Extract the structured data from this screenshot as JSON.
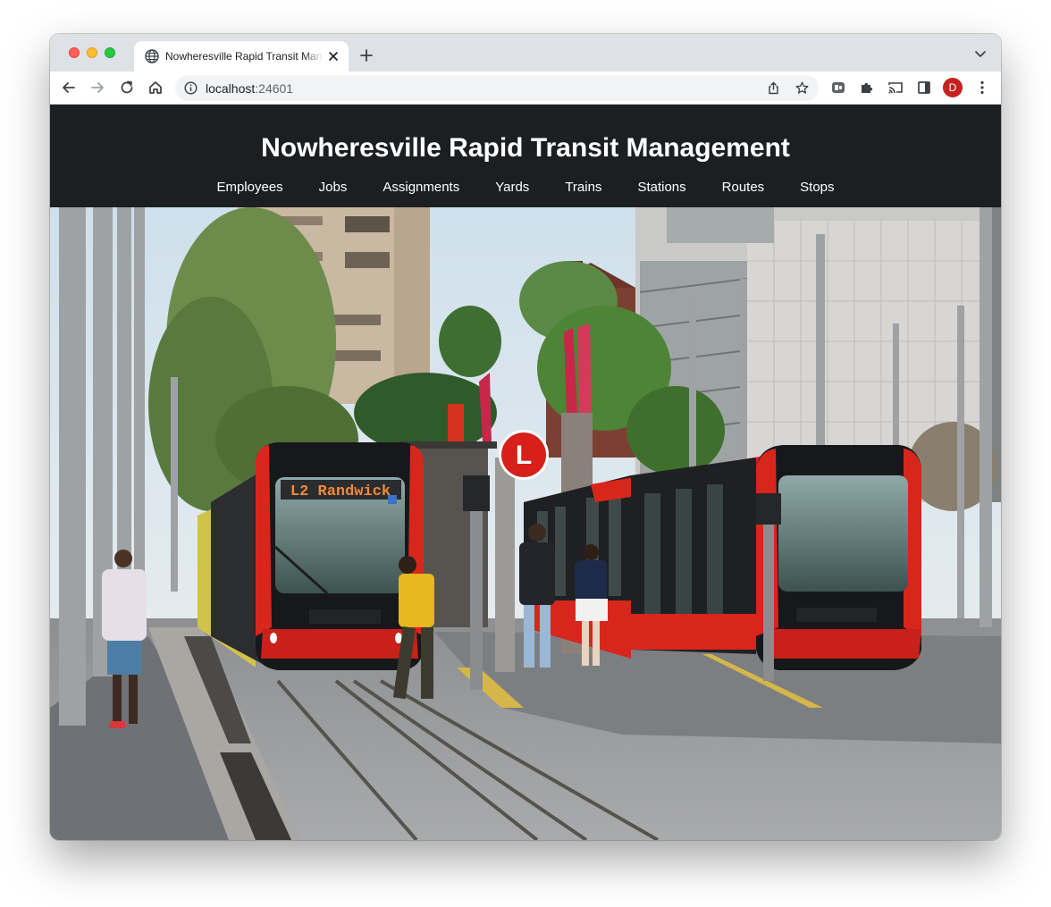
{
  "browser": {
    "tab_title": "Nowheresville Rapid Transit Management",
    "url_host": "localhost",
    "url_port": ":24601",
    "profile_initial": "D",
    "icons": {
      "favicon": "globe-icon",
      "tab_close": "close-icon",
      "new_tab": "plus-icon",
      "tab_search": "chevron-down-icon",
      "back": "arrow-left-icon",
      "forward": "arrow-right-icon",
      "reload": "reload-icon",
      "home": "home-icon",
      "site_info": "info-icon",
      "share": "share-icon",
      "bookmark": "star-icon",
      "extension_1": "extension-icon",
      "extensions": "puzzle-icon",
      "cast": "cast-icon",
      "side_panel": "side-panel-icon",
      "menu": "kebab-menu-icon"
    }
  },
  "site": {
    "title": "Nowheresville Rapid Transit Management",
    "nav": [
      {
        "label": "Employees"
      },
      {
        "label": "Jobs"
      },
      {
        "label": "Assignments"
      },
      {
        "label": "Yards"
      },
      {
        "label": "Trains"
      },
      {
        "label": "Stations"
      },
      {
        "label": "Routes"
      },
      {
        "label": "Stops"
      }
    ],
    "hero": {
      "tram_destination": "L2 Randwick",
      "stop_sign_letter": "L",
      "colors": {
        "header_bg": "#1c1f22",
        "tram_red": "#d9261c",
        "tram_black": "#16181b",
        "sky": "#d6e4ee"
      }
    }
  }
}
